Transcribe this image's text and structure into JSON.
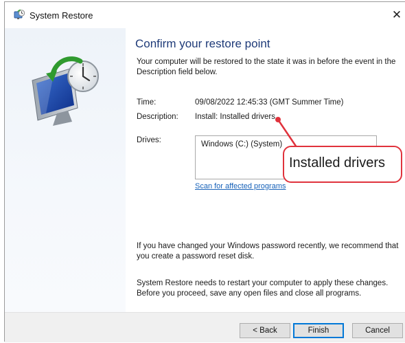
{
  "window": {
    "title": "System Restore",
    "close_glyph": "✕"
  },
  "page": {
    "heading": "Confirm your restore point",
    "intro": "Your computer will be restored to the state it was in before the event in the Description field below."
  },
  "details": {
    "time_label": "Time:",
    "time_value": "09/08/2022 12:45:33 (GMT Summer Time)",
    "description_label": "Description:",
    "description_value": "Install: Installed drivers",
    "drives_label": "Drives:",
    "drives": [
      "Windows (C:) (System)"
    ]
  },
  "links": {
    "scan": "Scan for affected programs"
  },
  "notes": {
    "password": "If you have changed your Windows password recently, we recommend that you create a password reset disk.",
    "restart": "System Restore needs to restart your computer to apply these changes. Before you proceed, save any open files and close all programs."
  },
  "buttons": {
    "back": "< Back",
    "finish": "Finish",
    "cancel": "Cancel"
  },
  "annotation": {
    "text": "Installed drivers",
    "color": "#e0323c"
  },
  "icons": {
    "title": "system-restore-icon",
    "hero": "system-restore-monitor-clock-icon"
  }
}
